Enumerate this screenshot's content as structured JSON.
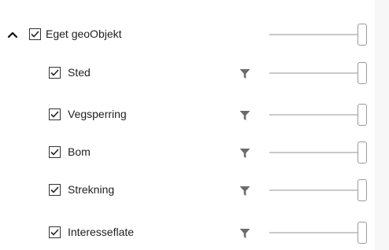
{
  "layer_tree": {
    "parent": {
      "label": "Eget geoObjekt",
      "expanded": true,
      "checked": true,
      "opacity": 1.0
    },
    "children": [
      {
        "label": "Sted",
        "checked": true,
        "filter_icon": "filter-icon",
        "opacity": 1.0
      },
      {
        "label": "Vegsperring",
        "checked": true,
        "filter_icon": "filter-icon",
        "opacity": 1.0
      },
      {
        "label": "Bom",
        "checked": true,
        "filter_icon": "filter-icon",
        "opacity": 1.0
      },
      {
        "label": "Strekning",
        "checked": true,
        "filter_icon": "filter-icon",
        "opacity": 1.0
      },
      {
        "label": "Interesseflate",
        "checked": true,
        "filter_icon": "filter-icon",
        "opacity": 1.0
      }
    ]
  },
  "colors": {
    "text": "#1f1f1f",
    "checkbox_border": "#333333",
    "filter_icon": "#6b6b6b",
    "slider_track": "#c9c9c9",
    "slider_thumb_border": "#9a9a9a",
    "side_strip": "#f7f7f7"
  }
}
